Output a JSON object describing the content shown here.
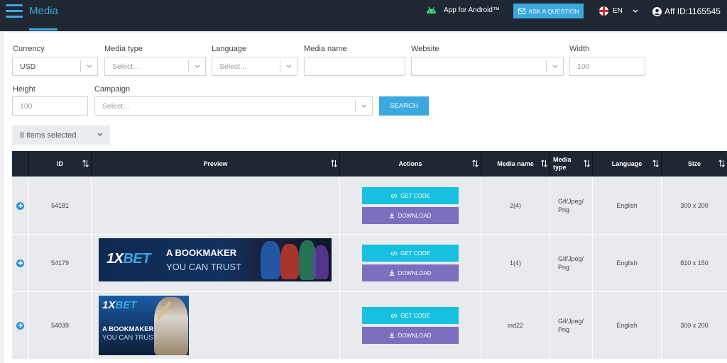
{
  "header": {
    "title": "Media",
    "android_label": "App for Android™",
    "ask_button": "ASK A QUESTION",
    "language": "EN",
    "aff_id": "Aff ID:1165545",
    "icons": [
      "menu-icon",
      "android-icon",
      "mail-icon",
      "uk-flag-icon",
      "chevron-down-icon",
      "user-icon"
    ]
  },
  "filters": {
    "currency": {
      "label": "Currency",
      "value": "USD"
    },
    "media_type": {
      "label": "Media type",
      "placeholder": "Select..."
    },
    "language": {
      "label": "Language",
      "placeholder": "Select..."
    },
    "media_name": {
      "label": "Media name",
      "value": ""
    },
    "website": {
      "label": "Website",
      "value": ""
    },
    "width": {
      "label": "Width",
      "placeholder": "100"
    },
    "height": {
      "label": "Height",
      "placeholder": "100"
    },
    "campaign": {
      "label": "Campaign",
      "placeholder": "Select..."
    },
    "search_button": "SEARCH",
    "columns_selector": "8 items selected"
  },
  "table": {
    "headers": {
      "id": "ID",
      "preview": "Preview",
      "actions": "Actions",
      "media_name": "Media name",
      "media_type_line1": "Media",
      "media_type_line2": "type",
      "language": "Language",
      "size": "Size"
    },
    "get_code_label": "GET CODE",
    "download_label": "DOWNLOAD",
    "rows": [
      {
        "id": "54181",
        "preview": "",
        "media_name": "2(4)",
        "media_type_line1": "Gif/Jpeg/",
        "media_type_line2": "Png",
        "language": "English",
        "size": "300 x 200"
      },
      {
        "id": "54179",
        "preview": "banner-wide",
        "media_name": "1(4)",
        "media_type_line1": "Gif/Jpeg/",
        "media_type_line2": "Png",
        "language": "English",
        "size": "810 x 150"
      },
      {
        "id": "54039",
        "preview": "banner-square",
        "media_name": "ind22",
        "media_type_line1": "Gif/Jpeg/",
        "media_type_line2": "Png",
        "language": "English",
        "size": "300 x 200"
      }
    ],
    "banner": {
      "logo_num": "1X",
      "logo_word": "BET",
      "line1": "A BOOKMAKER",
      "line2": "YOU CAN TRUST"
    }
  },
  "colors": {
    "topbar": "#1f2733",
    "accent": "#3aa9e0",
    "get_code": "#17c0e0",
    "download": "#7b6fbf",
    "row_bg": "#e8eaed"
  }
}
